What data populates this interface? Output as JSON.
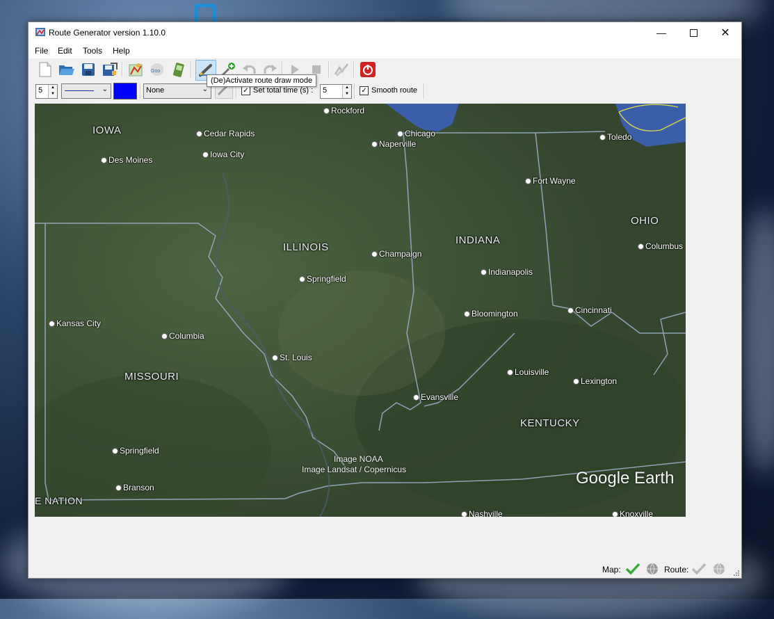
{
  "window": {
    "title": "Route Generator version 1.10.0"
  },
  "menu": [
    "File",
    "Edit",
    "Tools",
    "Help"
  ],
  "toolbar": {
    "tooltip": "(De)Activate route draw mode",
    "buttons": [
      "new-file",
      "open-folder",
      "save",
      "save-as",
      "map-pin",
      "google-earth",
      "gps-device",
      "route-draw",
      "add-point",
      "undo",
      "redo",
      "play",
      "stop",
      "smooth-path",
      "power"
    ]
  },
  "options": {
    "line_width": "5",
    "line_color": "#0000ff",
    "marker_style": "None",
    "set_total_time_label": "Set total time (s) :",
    "set_total_time_checked": true,
    "total_time": "5",
    "smooth_route_label": "Smooth route",
    "smooth_route_checked": true
  },
  "map": {
    "states": [
      "IOWA",
      "ILLINOIS",
      "INDIANA",
      "OHIO",
      "MISSOURI",
      "KENTUCKY",
      "E NATION"
    ],
    "cities": [
      "Rockford",
      "Chicago",
      "Naperville",
      "Toledo",
      "Cedar Rapids",
      "Iowa City",
      "Des Moines",
      "Fort Wayne",
      "Champaign",
      "Indianapolis",
      "Columbus",
      "Springfield",
      "Kansas City",
      "Columbia",
      "Bloomington",
      "Cincinnati",
      "St. Louis",
      "Louisville",
      "Lexington",
      "Evansville",
      "Springfield",
      "Branson",
      "Nashville",
      "Knoxville"
    ],
    "attribution": [
      "Image NOAA",
      "Image Landsat / Copernicus"
    ],
    "logo": "Google Earth"
  },
  "status": {
    "map_label": "Map:",
    "route_label": "Route:"
  },
  "colors": {
    "accent": "#1e8fd8",
    "water": "#3a5fa8",
    "ok": "#3aaa35"
  }
}
